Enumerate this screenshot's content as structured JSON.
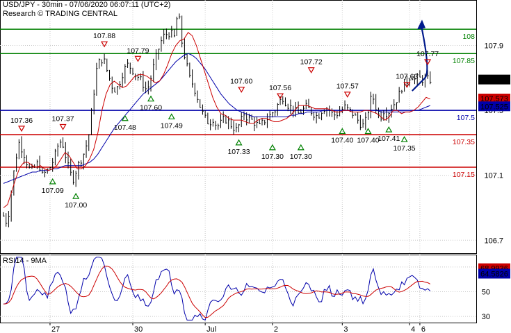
{
  "header": {
    "line1": "USD/JPY - 30min - 07/06/2020 06:07:11 (UTC+2)",
    "line2": "Research © TRADING CENTRAL"
  },
  "rsi_title": "RSI14 - 9MA",
  "colors": {
    "green": "#008000",
    "red": "#cc0000",
    "blue": "#0000aa",
    "navy": "#001a8c",
    "grid": "#c8c8c8"
  },
  "chart_data": {
    "type": "line",
    "price": {
      "ylim": [
        106.62,
        108.18
      ],
      "yticks": [
        "107.9",
        "107.5",
        "107.1",
        "106.7"
      ],
      "ytick_values": [
        107.9,
        107.5,
        107.1,
        106.7
      ],
      "x": [
        0,
        2,
        4,
        6,
        8,
        10,
        12,
        14,
        16,
        18,
        20,
        22,
        24,
        26,
        28,
        30,
        32,
        34,
        36,
        38,
        40,
        42,
        44,
        46,
        48,
        50,
        52,
        54,
        56,
        58,
        60,
        62,
        64,
        66,
        68,
        70,
        72,
        74,
        76,
        78,
        80,
        82,
        84,
        86,
        88,
        90,
        92,
        94,
        96,
        98,
        100,
        102,
        104,
        106,
        108,
        110,
        112,
        114,
        116,
        118,
        120,
        122,
        124,
        126,
        128,
        130,
        132,
        134,
        136,
        138,
        140,
        142,
        144,
        146,
        148,
        150,
        152,
        154,
        156,
        158,
        160,
        162,
        164,
        166,
        168,
        170,
        172,
        174,
        176,
        178,
        180,
        182,
        184,
        186,
        188,
        190,
        192,
        194,
        196,
        198,
        200,
        202,
        204,
        206,
        208,
        210,
        212,
        214,
        216,
        218,
        220,
        222,
        224,
        226,
        228,
        230,
        232,
        234,
        236,
        238,
        240,
        242,
        244,
        246,
        248,
        250,
        252,
        254,
        256,
        258,
        260,
        262,
        264,
        266,
        268,
        270,
        272,
        274,
        276,
        278,
        280,
        282,
        284,
        286,
        288,
        290
      ],
      "close": [
        106.85,
        106.8,
        107.0,
        107.18,
        107.3,
        107.25,
        107.18,
        107.12,
        107.15,
        107.18,
        107.1,
        107.12,
        107.15,
        107.2,
        107.28,
        107.32,
        107.22,
        107.12,
        107.08,
        107.15,
        107.2,
        107.25,
        107.35,
        107.55,
        107.75,
        107.82,
        107.8,
        107.72,
        107.65,
        107.62,
        107.68,
        107.75,
        107.78,
        107.76,
        107.72,
        107.7,
        107.66,
        107.62,
        107.7,
        107.8,
        107.88,
        107.95,
        107.97,
        107.98,
        107.95,
        108.12,
        107.92,
        107.8,
        107.7,
        107.65,
        107.58,
        107.5,
        107.45,
        107.42,
        107.45,
        107.4,
        107.42,
        107.45,
        107.43,
        107.4,
        107.38,
        107.42,
        107.48,
        107.45,
        107.44,
        107.42,
        107.4,
        107.43,
        107.45,
        107.48,
        107.5,
        107.55,
        107.58,
        107.54,
        107.52,
        107.5,
        107.48,
        107.5,
        107.52,
        107.5,
        107.48,
        107.46,
        107.5,
        107.52,
        107.5,
        107.47,
        107.48,
        107.5,
        107.52,
        107.5,
        107.48,
        107.45,
        107.42,
        107.4,
        107.5,
        107.6,
        107.52,
        107.45,
        107.5,
        107.48,
        107.52,
        107.55,
        107.6,
        107.66,
        107.68,
        107.72,
        107.69,
        107.7,
        107.69,
        107.69,
        107.69,
        107.69,
        107.69,
        107.69,
        107.69,
        107.69,
        107.69,
        107.69,
        107.69,
        107.69,
        107.69,
        107.69,
        107.69,
        107.69,
        107.69,
        107.69,
        107.69,
        107.69,
        107.69,
        107.69,
        107.69,
        107.69,
        107.69,
        107.69,
        107.69,
        107.69,
        107.69,
        107.69,
        107.69,
        107.69,
        107.69,
        107.69,
        107.69,
        107.69,
        107.69,
        107.69
      ],
      "n_bars": 111,
      "ma_fast": [
        106.9,
        106.92,
        107.0,
        107.08,
        107.15,
        107.18,
        107.18,
        107.16,
        107.15,
        107.16,
        107.14,
        107.13,
        107.14,
        107.16,
        107.2,
        107.24,
        107.22,
        107.18,
        107.14,
        107.14,
        107.16,
        107.2,
        107.26,
        107.36,
        107.5,
        107.6,
        107.66,
        107.68,
        107.66,
        107.64,
        107.65,
        107.68,
        107.71,
        107.72,
        107.72,
        107.71,
        107.69,
        107.67,
        107.68,
        107.72,
        107.78,
        107.85,
        107.9,
        107.93,
        107.94,
        107.98,
        107.96,
        107.9,
        107.82,
        107.74,
        107.66,
        107.58,
        107.52,
        107.48,
        107.47,
        107.45,
        107.44,
        107.44,
        107.44,
        107.43,
        107.42,
        107.42,
        107.44,
        107.45,
        107.45,
        107.44,
        107.43,
        107.43,
        107.44,
        107.45,
        107.47,
        107.5,
        107.53,
        107.53,
        107.53,
        107.52,
        107.51,
        107.51,
        107.51,
        107.51,
        107.5,
        107.49,
        107.49,
        107.5,
        107.5,
        107.49,
        107.49,
        107.49,
        107.5,
        107.5,
        107.49,
        107.48,
        107.46,
        107.44,
        107.46,
        107.5,
        107.5,
        107.48,
        107.49,
        107.49,
        107.5,
        107.52,
        107.55,
        107.58,
        107.57
      ],
      "ma_slow": [
        107.05,
        107.06,
        107.07,
        107.08,
        107.09,
        107.1,
        107.11,
        107.12,
        107.12,
        107.13,
        107.13,
        107.13,
        107.14,
        107.14,
        107.15,
        107.16,
        107.16,
        107.16,
        107.16,
        107.16,
        107.17,
        107.18,
        107.2,
        107.23,
        107.27,
        107.31,
        107.35,
        107.39,
        107.42,
        107.45,
        107.48,
        107.51,
        107.54,
        107.57,
        107.6,
        107.62,
        107.64,
        107.66,
        107.68,
        107.71,
        107.74,
        107.77,
        107.8,
        107.82,
        107.84,
        107.85,
        107.84,
        107.82,
        107.79,
        107.76,
        107.72,
        107.68,
        107.64,
        107.6,
        107.57,
        107.54,
        107.52,
        107.5,
        107.49,
        107.48,
        107.47,
        107.46,
        107.46,
        107.46,
        107.46,
        107.46,
        107.46,
        107.46,
        107.46,
        107.46,
        107.47,
        107.47,
        107.48,
        107.48,
        107.49,
        107.49,
        107.49,
        107.49,
        107.5,
        107.5,
        107.5,
        107.5,
        107.5,
        107.5,
        107.5,
        107.5,
        107.5,
        107.5,
        107.5,
        107.5,
        107.5,
        107.5,
        107.49,
        107.49,
        107.49,
        107.49,
        107.49,
        107.49,
        107.49,
        107.49,
        107.5,
        107.5,
        107.51,
        107.52,
        107.53
      ]
    },
    "levels": [
      {
        "label": "108",
        "value": 108.0,
        "color": "green"
      },
      {
        "label": "107.85",
        "value": 107.85,
        "color": "green"
      },
      {
        "label": "107.5",
        "value": 107.5,
        "color": "blue"
      },
      {
        "label": "107.35",
        "value": 107.35,
        "color": "red"
      },
      {
        "label": "107.15",
        "value": 107.15,
        "color": "red"
      }
    ],
    "price_tags": [
      {
        "label": "107.69",
        "value": 107.69,
        "bg": "#000000"
      },
      {
        "label": "107.573",
        "value": 107.573,
        "bg": "#cc0000"
      },
      {
        "label": "107.525",
        "value": 107.525,
        "bg": "#0000aa"
      }
    ],
    "annotations": [
      {
        "text": "107.36",
        "bar": 7,
        "value": 107.36,
        "kind": "high"
      },
      {
        "text": "107.37",
        "bar": 23,
        "value": 107.37,
        "kind": "high"
      },
      {
        "text": "107.88",
        "bar": 39,
        "value": 107.88,
        "kind": "high"
      },
      {
        "text": "107.79",
        "bar": 52,
        "value": 107.79,
        "kind": "high"
      },
      {
        "text": "107.60",
        "bar": 92,
        "value": 107.6,
        "kind": "high"
      },
      {
        "text": "107.56",
        "bar": 107,
        "value": 107.56,
        "kind": "high"
      },
      {
        "text": "107.72",
        "bar": 119,
        "value": 107.72,
        "kind": "high"
      },
      {
        "text": "107.57",
        "bar": 133,
        "value": 107.57,
        "kind": "high"
      },
      {
        "text": "107.63",
        "bar": 156,
        "value": 107.63,
        "kind": "high"
      },
      {
        "text": "107.77",
        "bar": 164,
        "value": 107.77,
        "kind": "high"
      },
      {
        "text": "107.09",
        "bar": 19,
        "value": 107.09,
        "kind": "low"
      },
      {
        "text": "107.00",
        "bar": 28,
        "value": 107.0,
        "kind": "low"
      },
      {
        "text": "107.48",
        "bar": 47,
        "value": 107.48,
        "kind": "low"
      },
      {
        "text": "107.60",
        "bar": 57,
        "value": 107.6,
        "kind": "low"
      },
      {
        "text": "107.49",
        "bar": 65,
        "value": 107.49,
        "kind": "low"
      },
      {
        "text": "107.33",
        "bar": 91,
        "value": 107.33,
        "kind": "low"
      },
      {
        "text": "107.30",
        "bar": 104,
        "value": 107.3,
        "kind": "low"
      },
      {
        "text": "107.30",
        "bar": 115,
        "value": 107.3,
        "kind": "low"
      },
      {
        "text": "107.40",
        "bar": 131,
        "value": 107.4,
        "kind": "low"
      },
      {
        "text": "107.40",
        "bar": 141,
        "value": 107.4,
        "kind": "low"
      },
      {
        "text": "107.41",
        "bar": 149,
        "value": 107.41,
        "kind": "low"
      },
      {
        "text": "107.35",
        "bar": 155,
        "value": 107.35,
        "kind": "low"
      }
    ],
    "rsi": {
      "ylim": [
        25,
        80
      ],
      "yticks": [
        "70",
        "50",
        "30"
      ],
      "ytick_values": [
        70,
        50,
        30
      ],
      "tags": [
        {
          "label": "68.9936",
          "value": 68.99,
          "bg": "#cc0000"
        },
        {
          "label": "64.5826",
          "value": 64.58,
          "bg": "#0000aa"
        }
      ]
    },
    "x_ticks": [
      {
        "label": "27",
        "bar": 18
      },
      {
        "label": "30",
        "bar": 50
      },
      {
        "label": "Jul",
        "bar": 78
      },
      {
        "label": "2",
        "bar": 104
      },
      {
        "label": "3",
        "bar": 131
      },
      {
        "label": "4",
        "bar": 157
      },
      {
        "label": "6",
        "bar": 161
      }
    ]
  }
}
